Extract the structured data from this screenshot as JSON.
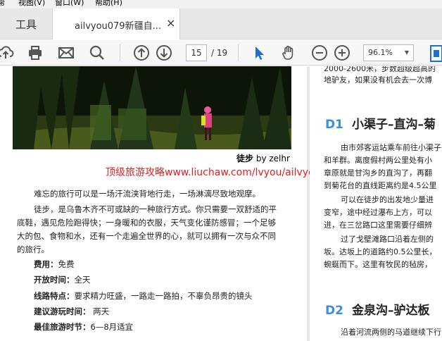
{
  "menu": {
    "items": [
      "帮",
      "视图(V)",
      "窗口(W)",
      "帮助(H)"
    ]
  },
  "tabs": {
    "tools_label": "工具",
    "doc_label": "ailvyou079新疆自...",
    "close_glyph": "×"
  },
  "toolbar": {
    "page_current": "15",
    "page_total": "/ 19",
    "zoom": "96.1%"
  },
  "page_left": {
    "caption_bold": "徒步",
    "caption_rest": " by zelhr",
    "watermark": "顶级旅游攻略www.liuchaw.com/lvyou/ailvyou",
    "paragraph1": "难忘的旅行可以是一场汗流浃背地行走，一场淋漓尽致地观摩。",
    "paragraph2_lines": [
      "徒步，是乌鲁木齐不可或缺的一种旅行方式。你只需要一双舒适的平",
      "底鞋，遇见危险跑得快；一身暖和的衣服，天气变化谨防感冒；一个足够",
      "大的包、食物和水，还有一个走遍全世界的心，就可以拥有一次与众不同",
      "的旅行。"
    ],
    "info": [
      {
        "label": "费用：",
        "value": "免费"
      },
      {
        "label": "开放时间：",
        "value": "全天"
      },
      {
        "label": "线路特点：",
        "value": "要求精力旺盛，一路走一路拍，不辜负昂贵的镜头"
      },
      {
        "label": "建议游玩时间：",
        "value": " 两天"
      },
      {
        "label": "最佳旅游时节：",
        "value": "6—8月适宜"
      }
    ]
  },
  "page_right": {
    "top_lines": [
      "2000-2600米，步数超级超高的",
      "地驴友，如果没有机会去一次博"
    ],
    "section1": {
      "code": "D1",
      "title": "小渠子–直沟–菊"
    },
    "section1_lines": [
      "由市郊客运站乘车前往小渠子",
      "和羊群。离度假村两公里处有小",
      "章原就是甘沟乡的直沟了，再翻",
      "到菊花台的直线距离约是4.5公里",
      "可以在徒步的出发地少量进",
      "变窄，途中经过瀑布上方，可以",
      "进，在三岔路口这里需要仔细辨"
    ],
    "section1_lines_b": [
      "过了戈壁滩路口沿着左侧的",
      "坂。达坂上的道路约0.5公里长，",
      "蜿蜒而下。这里有牧民的毡房，"
    ],
    "section2": {
      "code": "D2",
      "title": "金泉沟–驴达板"
    },
    "section2_lines": [
      "沿着河流两侧的马道继续下行"
    ]
  }
}
